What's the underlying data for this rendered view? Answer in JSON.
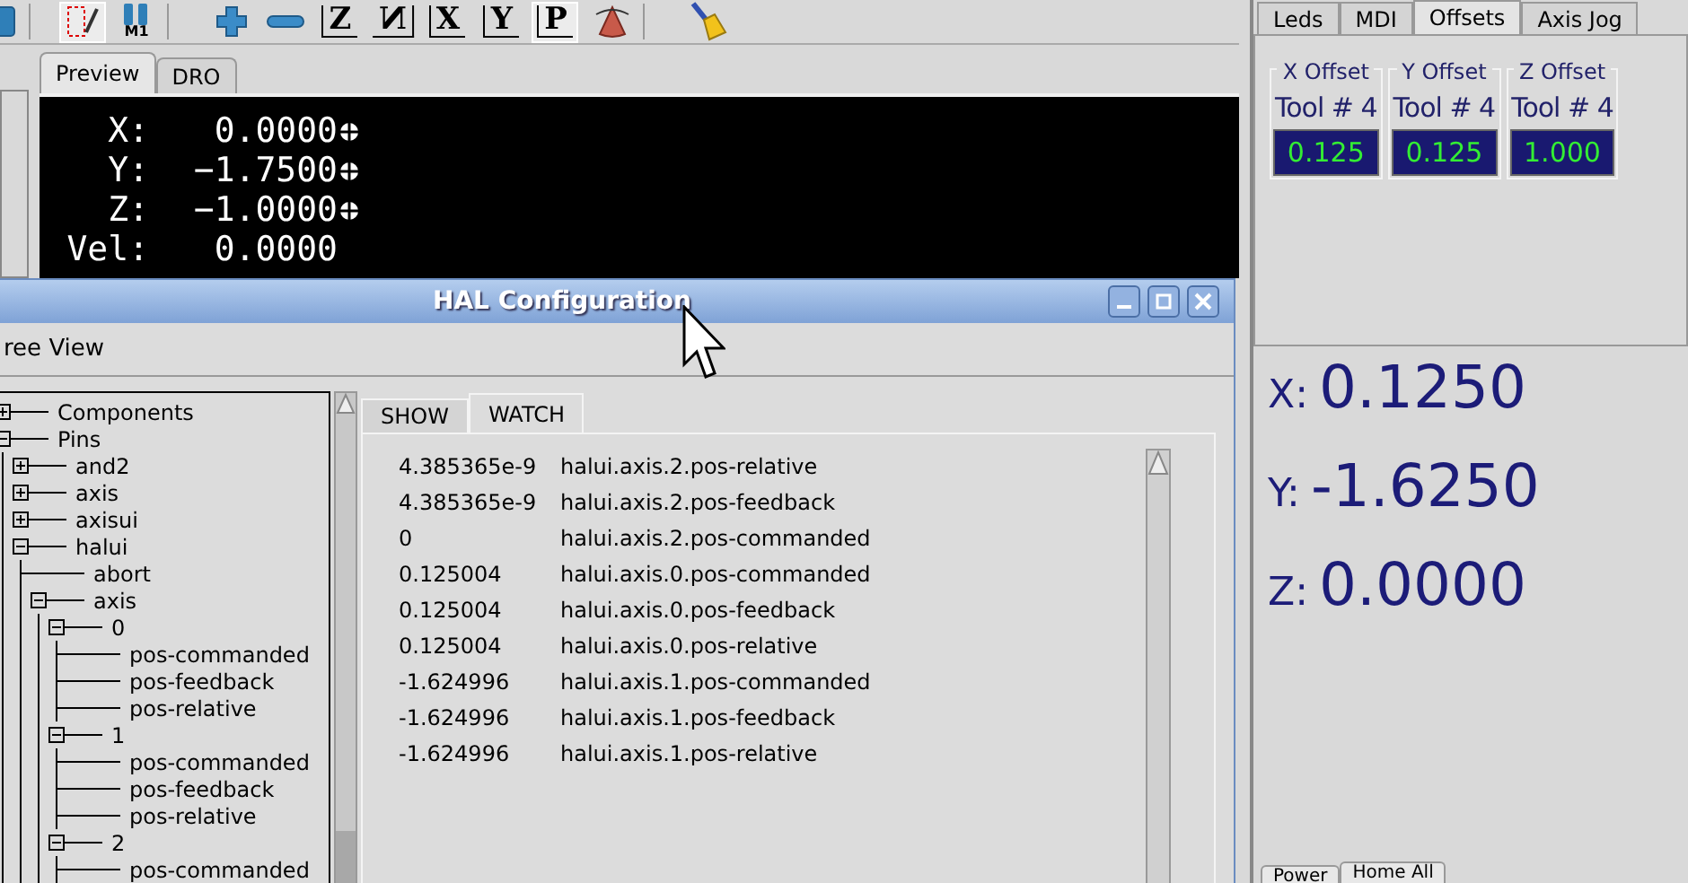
{
  "toolbar": [
    {
      "kind": "square",
      "selected": false
    },
    {
      "kind": "pen",
      "selected": true
    },
    {
      "kind": "m1",
      "label": "M1",
      "selected": false
    },
    {
      "kind": "plus",
      "selected": false
    },
    {
      "kind": "minus",
      "selected": false
    },
    {
      "kind": "letter",
      "label": "Z",
      "selected": false
    },
    {
      "kind": "letter-flipped",
      "label": "N",
      "selected": false
    },
    {
      "kind": "letter",
      "label": "X",
      "selected": false
    },
    {
      "kind": "letter",
      "label": "Y",
      "selected": false
    },
    {
      "kind": "letter",
      "label": "P",
      "selected": true
    },
    {
      "kind": "cone",
      "selected": false
    },
    {
      "kind": "broom",
      "selected": false
    }
  ],
  "view_tabs": [
    {
      "label": "Preview",
      "selected": true
    },
    {
      "label": "DRO",
      "selected": false
    }
  ],
  "preview_dro": [
    {
      "axis": "X:",
      "value": "0.0000",
      "homed": true
    },
    {
      "axis": "Y:",
      "value": "−1.7500",
      "homed": true
    },
    {
      "axis": "Z:",
      "value": "−1.0000",
      "homed": true
    },
    {
      "axis": "Vel:",
      "value": "0.0000",
      "homed": false
    }
  ],
  "side_tabs": [
    {
      "label": "Leds",
      "selected": false
    },
    {
      "label": "MDI",
      "selected": false
    },
    {
      "label": "Offsets",
      "selected": true
    },
    {
      "label": "Axis Jog",
      "selected": false
    }
  ],
  "offsets": [
    {
      "title": "X Offset",
      "tool": "Tool # 4",
      "value": "0.125"
    },
    {
      "title": "Y Offset",
      "tool": "Tool # 4",
      "value": "0.125"
    },
    {
      "title": "Z Offset",
      "tool": "Tool # 4",
      "value": "1.000"
    }
  ],
  "big_dro": [
    {
      "axis": "X:",
      "value": "0.1250"
    },
    {
      "axis": "Y:",
      "value": "-1.6250"
    },
    {
      "axis": "Z:",
      "value": "0.0000"
    }
  ],
  "bottom_tabs": [
    {
      "label": "Power",
      "selected": false
    },
    {
      "label": "Home All",
      "selected": true
    }
  ],
  "hal_window": {
    "title": "HAL Configuration",
    "menu": [
      "ree View"
    ],
    "tree": [
      {
        "label": "Components",
        "expanded": false
      },
      {
        "label": "Pins",
        "expanded": true,
        "children": [
          {
            "label": "and2",
            "expanded": false
          },
          {
            "label": "axis",
            "expanded": false
          },
          {
            "label": "axisui",
            "expanded": false
          },
          {
            "label": "halui",
            "expanded": true,
            "children": [
              {
                "label": "abort"
              },
              {
                "label": "axis",
                "expanded": true,
                "children": [
                  {
                    "label": "0",
                    "expanded": true,
                    "children": [
                      {
                        "label": "pos-commanded"
                      },
                      {
                        "label": "pos-feedback"
                      },
                      {
                        "label": "pos-relative"
                      }
                    ]
                  },
                  {
                    "label": "1",
                    "expanded": true,
                    "children": [
                      {
                        "label": "pos-commanded"
                      },
                      {
                        "label": "pos-feedback"
                      },
                      {
                        "label": "pos-relative"
                      }
                    ]
                  },
                  {
                    "label": "2",
                    "expanded": true,
                    "children": [
                      {
                        "label": "pos-commanded"
                      }
                    ]
                  }
                ]
              }
            ]
          }
        ]
      }
    ],
    "tabs": [
      {
        "label": "SHOW",
        "selected": false
      },
      {
        "label": "WATCH",
        "selected": true
      }
    ],
    "watch": [
      {
        "value": "4.385365e-9",
        "pin": "halui.axis.2.pos-relative"
      },
      {
        "value": "4.385365e-9",
        "pin": "halui.axis.2.pos-feedback"
      },
      {
        "value": "0",
        "pin": "halui.axis.2.pos-commanded"
      },
      {
        "value": "0.125004",
        "pin": "halui.axis.0.pos-commanded"
      },
      {
        "value": "0.125004",
        "pin": "halui.axis.0.pos-feedback"
      },
      {
        "value": "0.125004",
        "pin": "halui.axis.0.pos-relative"
      },
      {
        "value": "-1.624996",
        "pin": "halui.axis.1.pos-commanded"
      },
      {
        "value": "-1.624996",
        "pin": "halui.axis.1.pos-feedback"
      },
      {
        "value": "-1.624996",
        "pin": "halui.axis.1.pos-relative"
      }
    ]
  }
}
